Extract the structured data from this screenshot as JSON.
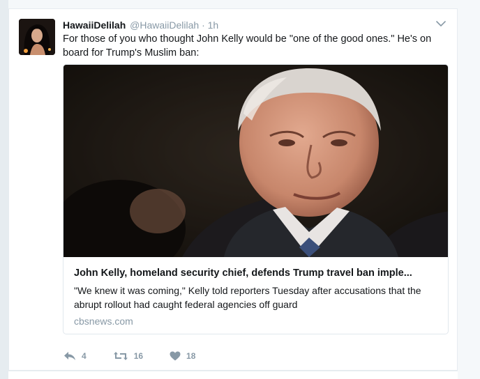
{
  "tweet": {
    "display_name": "HawaiiDelilah",
    "handle": "@HawaiiDelilah",
    "separator": "·",
    "time": "1h",
    "text": "For those of you who thought John Kelly would be \"one of the good ones.\" He's on board for Trump's Muslim ban:"
  },
  "link_card": {
    "title": "John Kelly, homeland security chief, defends Trump travel ban imple...",
    "description": "\"We knew it was coming,\" Kelly told reporters Tuesday after accusations that the abrupt rollout had caught federal agencies off guard",
    "domain": "cbsnews.com"
  },
  "actions": {
    "reply_count": "4",
    "retweet_count": "16",
    "like_count": "18"
  },
  "icons": {
    "caret": "chevron-down-icon",
    "reply": "reply-icon",
    "retweet": "retweet-icon",
    "like": "heart-icon"
  },
  "colors": {
    "text_primary": "#14171a",
    "text_secondary": "#8899a6",
    "border": "#e1e8ed",
    "page_bg": "#f5f8fa"
  }
}
